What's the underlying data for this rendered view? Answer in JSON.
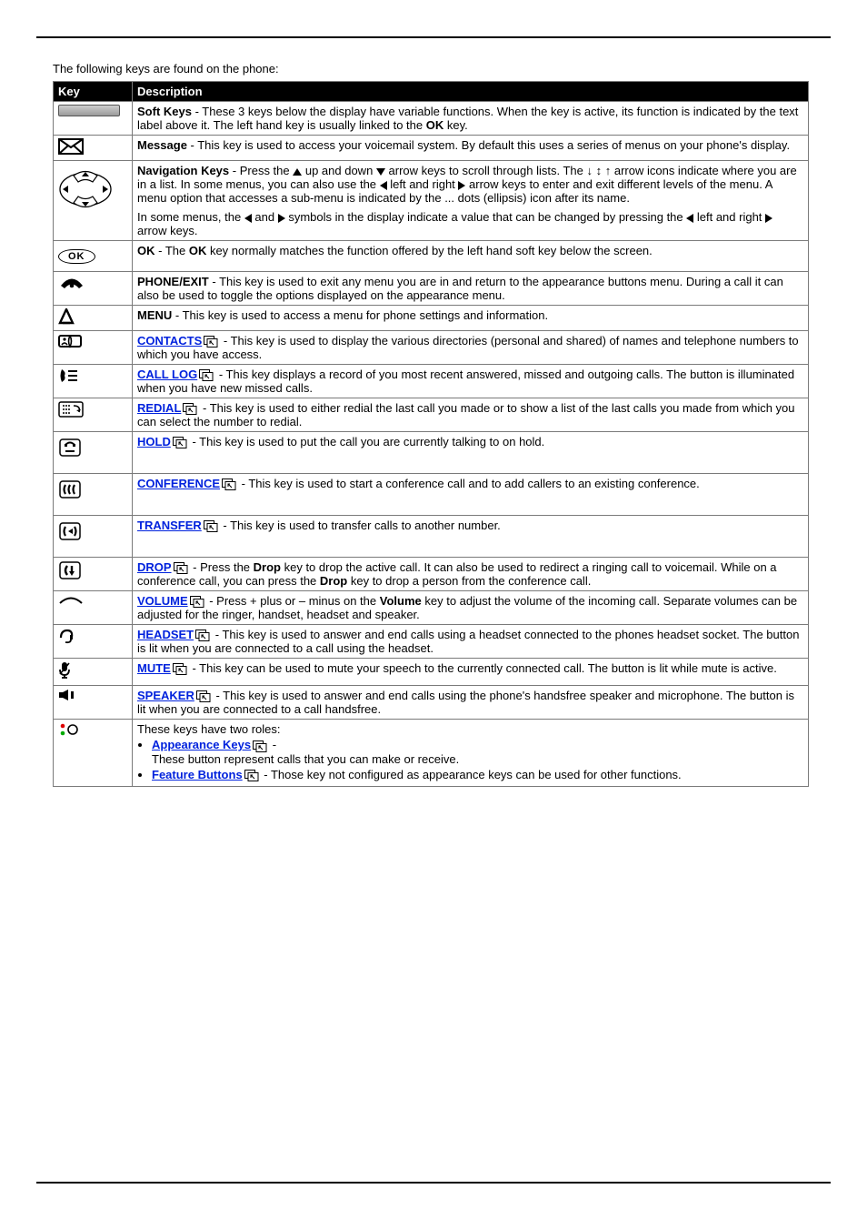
{
  "intro": "The following keys are found on the phone:",
  "headers": {
    "key": "Key",
    "desc": "Description"
  },
  "rows": {
    "soft": {
      "label": "Soft Keys",
      "body": " - These 3 keys below the display have variable functions. When the key is active, its function is indicated by the text label above it. The left hand key is usually linked to the ",
      "label2": "OK",
      "tail": " key."
    },
    "message": {
      "label": "Message",
      "body": " - This key is used to access your voicemail system. By default this uses a series of menus on your phone's display."
    },
    "nav": {
      "label": "Navigation Keys",
      "p1a": " - Press the ",
      "p1b": " up and down ",
      "p1c": " arrow keys to scroll through lists. The ",
      "arrows_text": "↓ ↕ ↑",
      "p1d": " arrow icons indicate where you are in a list. In some menus, you can also use the ",
      "p1e": " left and right ",
      "p1f": " arrow keys to enter and exit different levels of the menu. A menu option that accesses a sub-menu is indicated by the ... dots (ellipsis) icon after its name.",
      "p2a": "In some menus, the ",
      "p2b": " and ",
      "p2c": " symbols in the display indicate a value that can be changed by pressing the ",
      "p2d": " left and right ",
      "p2e": " arrow keys."
    },
    "ok": {
      "label": "OK",
      "pre": " - The ",
      "label2": "OK",
      "body": " key normally matches the function offered by the left hand soft key below the screen."
    },
    "phone": {
      "label": "PHONE/EXIT",
      "body": " - This key is used to exit any menu you are in and return to the appearance buttons menu. During a call it can also be used to toggle the options displayed on the appearance menu."
    },
    "menu": {
      "label": "MENU",
      "body": " - This key is used to access a menu for phone settings and information."
    },
    "contacts": {
      "link": "CONTACTS",
      "body": " - This key is used to display the various directories (personal and shared) of names and telephone numbers to which you have access."
    },
    "calllog": {
      "link": "CALL LOG",
      "body": " - This key displays a record of you most recent answered, missed and outgoing calls. The button is illuminated when you have new missed calls."
    },
    "redial": {
      "link": "REDIAL",
      "body": " - This key is used to either redial the last call you made or to show a list of the last calls you made from which you can select the number to redial."
    },
    "hold": {
      "link": "HOLD",
      "body": " - This key is used to put the call you are currently talking to on hold."
    },
    "conf": {
      "link": "CONFERENCE",
      "body": " - This key is used to start a conference call and to add callers to an existing conference."
    },
    "transfer": {
      "link": "TRANSFER",
      "body": " - This key is used to transfer calls to another number."
    },
    "drop": {
      "link": "DROP",
      "pre": " - Press the ",
      "lbl1": "Drop",
      "mid": " key to drop the active call. It can also be used to redirect a ringing call to voicemail. While on a conference call, you can press the ",
      "lbl2": "Drop",
      "tail": " key to drop a person from the conference call."
    },
    "volume": {
      "link": "VOLUME",
      "pre": " - Press + plus or – minus on the ",
      "lbl": "Volume",
      "tail": " key to adjust the volume of the incoming call. Separate volumes can be adjusted for the ringer, handset, headset and speaker."
    },
    "headset": {
      "link": "HEADSET",
      "body": " - This key is used to answer and end calls using a headset connected to the phones headset socket. The button is lit when you are connected to a call using the headset."
    },
    "mute": {
      "link": "MUTE",
      "body": " - This key can be used to mute your speech to the currently connected call. The button is lit while mute is active."
    },
    "speaker": {
      "link": "SPEAKER",
      "body": " - This key is used to answer and end calls using the phone's handsfree speaker and microphone. The button is lit when you are connected to a call handsfree."
    },
    "appfeat": {
      "intro": "These keys have two roles:",
      "appearance_link": "Appearance Keys",
      "appearance_dash": " -",
      "appearance_body": "These button represent calls that you can make or receive.",
      "feature_link": "Feature Buttons",
      "feature_body": " - Those key not configured as appearance keys can be used for other functions."
    }
  }
}
